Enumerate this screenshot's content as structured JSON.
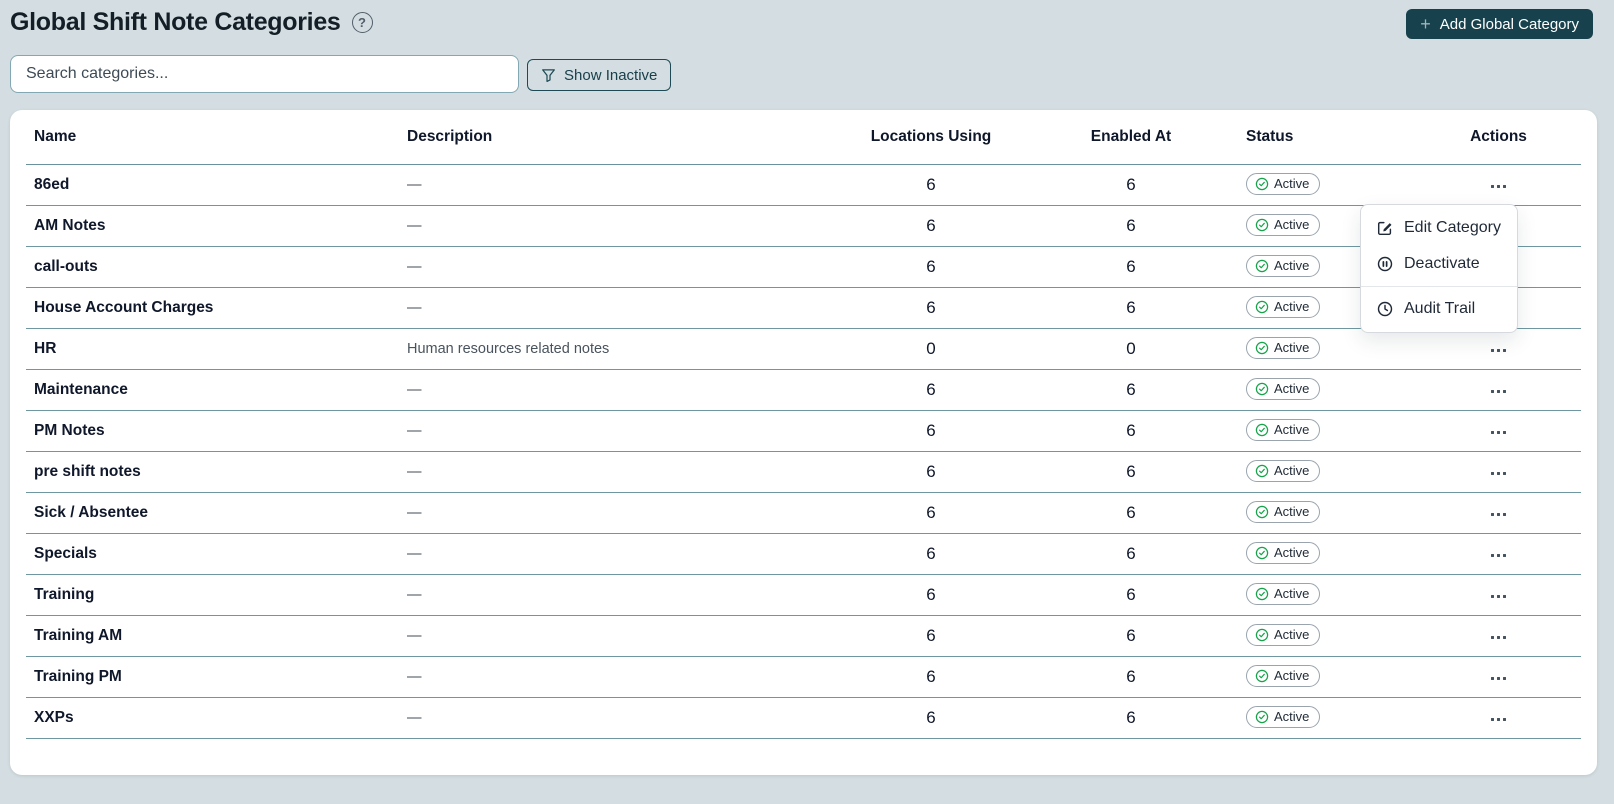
{
  "page": {
    "title": "Global Shift Note Categories",
    "help_glyph": "?"
  },
  "header": {
    "add_button_label": "Add Global Category",
    "plus_glyph": "+"
  },
  "toolbar": {
    "search_placeholder": "Search categories...",
    "show_inactive_label": "Show Inactive"
  },
  "table": {
    "columns": [
      "Name",
      "Description",
      "Locations Using",
      "Enabled At",
      "Status",
      "Actions"
    ],
    "rows": [
      {
        "name": "86ed",
        "description": "—",
        "locations_using": "6",
        "enabled_at": "6",
        "status": "Active"
      },
      {
        "name": "AM Notes",
        "description": "—",
        "locations_using": "6",
        "enabled_at": "6",
        "status": "Active"
      },
      {
        "name": "call-outs",
        "description": "—",
        "locations_using": "6",
        "enabled_at": "6",
        "status": "Active"
      },
      {
        "name": "House Account Charges",
        "description": "—",
        "locations_using": "6",
        "enabled_at": "6",
        "status": "Active"
      },
      {
        "name": "HR",
        "description": "Human resources related notes",
        "locations_using": "0",
        "enabled_at": "0",
        "status": "Active"
      },
      {
        "name": "Maintenance",
        "description": "—",
        "locations_using": "6",
        "enabled_at": "6",
        "status": "Active"
      },
      {
        "name": "PM Notes",
        "description": "—",
        "locations_using": "6",
        "enabled_at": "6",
        "status": "Active"
      },
      {
        "name": "pre shift notes",
        "description": "—",
        "locations_using": "6",
        "enabled_at": "6",
        "status": "Active"
      },
      {
        "name": "Sick / Absentee",
        "description": "—",
        "locations_using": "6",
        "enabled_at": "6",
        "status": "Active"
      },
      {
        "name": "Specials",
        "description": "—",
        "locations_using": "6",
        "enabled_at": "6",
        "status": "Active"
      },
      {
        "name": "Training",
        "description": "—",
        "locations_using": "6",
        "enabled_at": "6",
        "status": "Active"
      },
      {
        "name": "Training AM",
        "description": "—",
        "locations_using": "6",
        "enabled_at": "6",
        "status": "Active"
      },
      {
        "name": "Training PM",
        "description": "—",
        "locations_using": "6",
        "enabled_at": "6",
        "status": "Active"
      },
      {
        "name": "XXPs",
        "description": "—",
        "locations_using": "6",
        "enabled_at": "6",
        "status": "Active"
      }
    ]
  },
  "menu": {
    "items": [
      {
        "label": "Edit Category",
        "icon": "edit-icon"
      },
      {
        "label": "Deactivate",
        "icon": "pause-circle-icon"
      },
      {
        "label": "Audit Trail",
        "icon": "clock-icon"
      }
    ]
  },
  "colors": {
    "page_background": "#d4dee2",
    "primary_teal": "#16414d",
    "row_divider": "#6f97a2",
    "status_green": "#16a34a",
    "search_border": "#84a8b3"
  }
}
